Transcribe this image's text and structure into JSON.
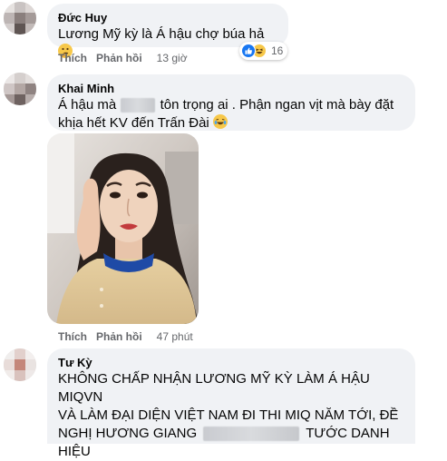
{
  "comments": [
    {
      "author": "Đức Huy",
      "text": "Lương Mỹ kỳ là Á hậu chợ búa hả",
      "emoji": "thinking-face",
      "reaction_count": "16",
      "like_label": "Thích",
      "reply_label": "Phản hồi",
      "time": "13 giờ"
    },
    {
      "author": "Khai Minh",
      "text_part1": "Á hậu mà",
      "text_part2": "tôn trọng ai . Phận ngan vịt mà bày đặt",
      "text_line2": "khịa hết KV đến Trấn Đài",
      "emoji": "laughing-face",
      "like_label": "Thích",
      "reply_label": "Phản hồi",
      "time": "47 phút"
    },
    {
      "author": "Tư Kỳ",
      "line1": "KHÔNG CHẤP NHẬN LƯƠNG MỸ KỲ LÀM Á HẬU MIQVN",
      "line2": "VÀ LÀM ĐẠI DIỆN VIỆT NAM ĐI THI MIQ NĂM TỚI, ĐỀ",
      "line3a": "NGHỊ HƯƠNG GIANG",
      "line3b": "TƯỚC DANH",
      "line4": "HIỆU"
    }
  ],
  "colors": {
    "bubble": "#f0f2f5",
    "meta_text": "#65676b",
    "like_blue": "#1877f2",
    "haha_yellow": "#f7c84a"
  }
}
